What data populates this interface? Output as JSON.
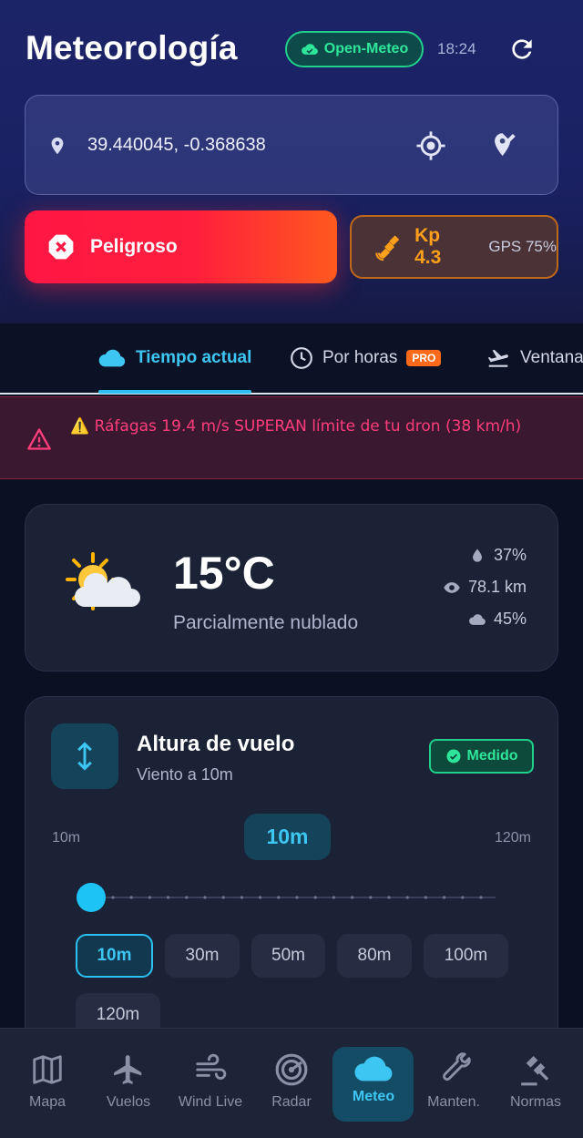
{
  "header": {
    "title": "Meteorología",
    "source_badge": "Open-Meteo",
    "time": "18:24",
    "refresh_icon": "refresh-icon"
  },
  "location": {
    "coords": "39.440045, -0.368638",
    "pin_icon": "location-pin-icon",
    "gps_icon": "gps-target-icon",
    "edit_icon": "pin-edit-icon"
  },
  "status": {
    "danger_label": "Peligroso",
    "kp_label": "Kp 4.3",
    "gps_label": "GPS 75%"
  },
  "tabs": [
    {
      "label": "Tiempo actual",
      "icon": "cloud-icon",
      "active": true
    },
    {
      "label": "Por horas",
      "icon": "clock-icon",
      "badge": "PRO"
    },
    {
      "label": "Ventana",
      "icon": "takeoff-icon"
    }
  ],
  "alert": {
    "text": "⚠️ Ráfagas 19.4 m/s SUPERAN límite de tu dron (38 km/h)"
  },
  "weather": {
    "temp": "15°C",
    "condition": "Parcialmente nublado",
    "humidity": "37%",
    "visibility": "78.1 km",
    "clouds": "45%"
  },
  "flight_height": {
    "title": "Altura de vuelo",
    "subtitle": "Viento a 10m",
    "badge": "Medido",
    "range_min": "10m",
    "range_max": "120m",
    "current": "10m",
    "slider_fraction": 0,
    "options": [
      "10m",
      "30m",
      "50m",
      "80m",
      "100m",
      "120m"
    ],
    "selected": "10m"
  },
  "nav": [
    {
      "label": "Mapa",
      "icon": "map-icon"
    },
    {
      "label": "Vuelos",
      "icon": "airplane-icon"
    },
    {
      "label": "Wind Live",
      "icon": "wind-icon"
    },
    {
      "label": "Radar",
      "icon": "radar-icon"
    },
    {
      "label": "Meteo",
      "icon": "cloud-icon",
      "active": true
    },
    {
      "label": "Manten.",
      "icon": "wrench-icon"
    },
    {
      "label": "Normas",
      "icon": "gavel-icon"
    }
  ],
  "colors": {
    "accent": "#3ec6f2",
    "danger": "#ff1744",
    "success": "#2ee69a",
    "warning": "#ff9f1a"
  }
}
